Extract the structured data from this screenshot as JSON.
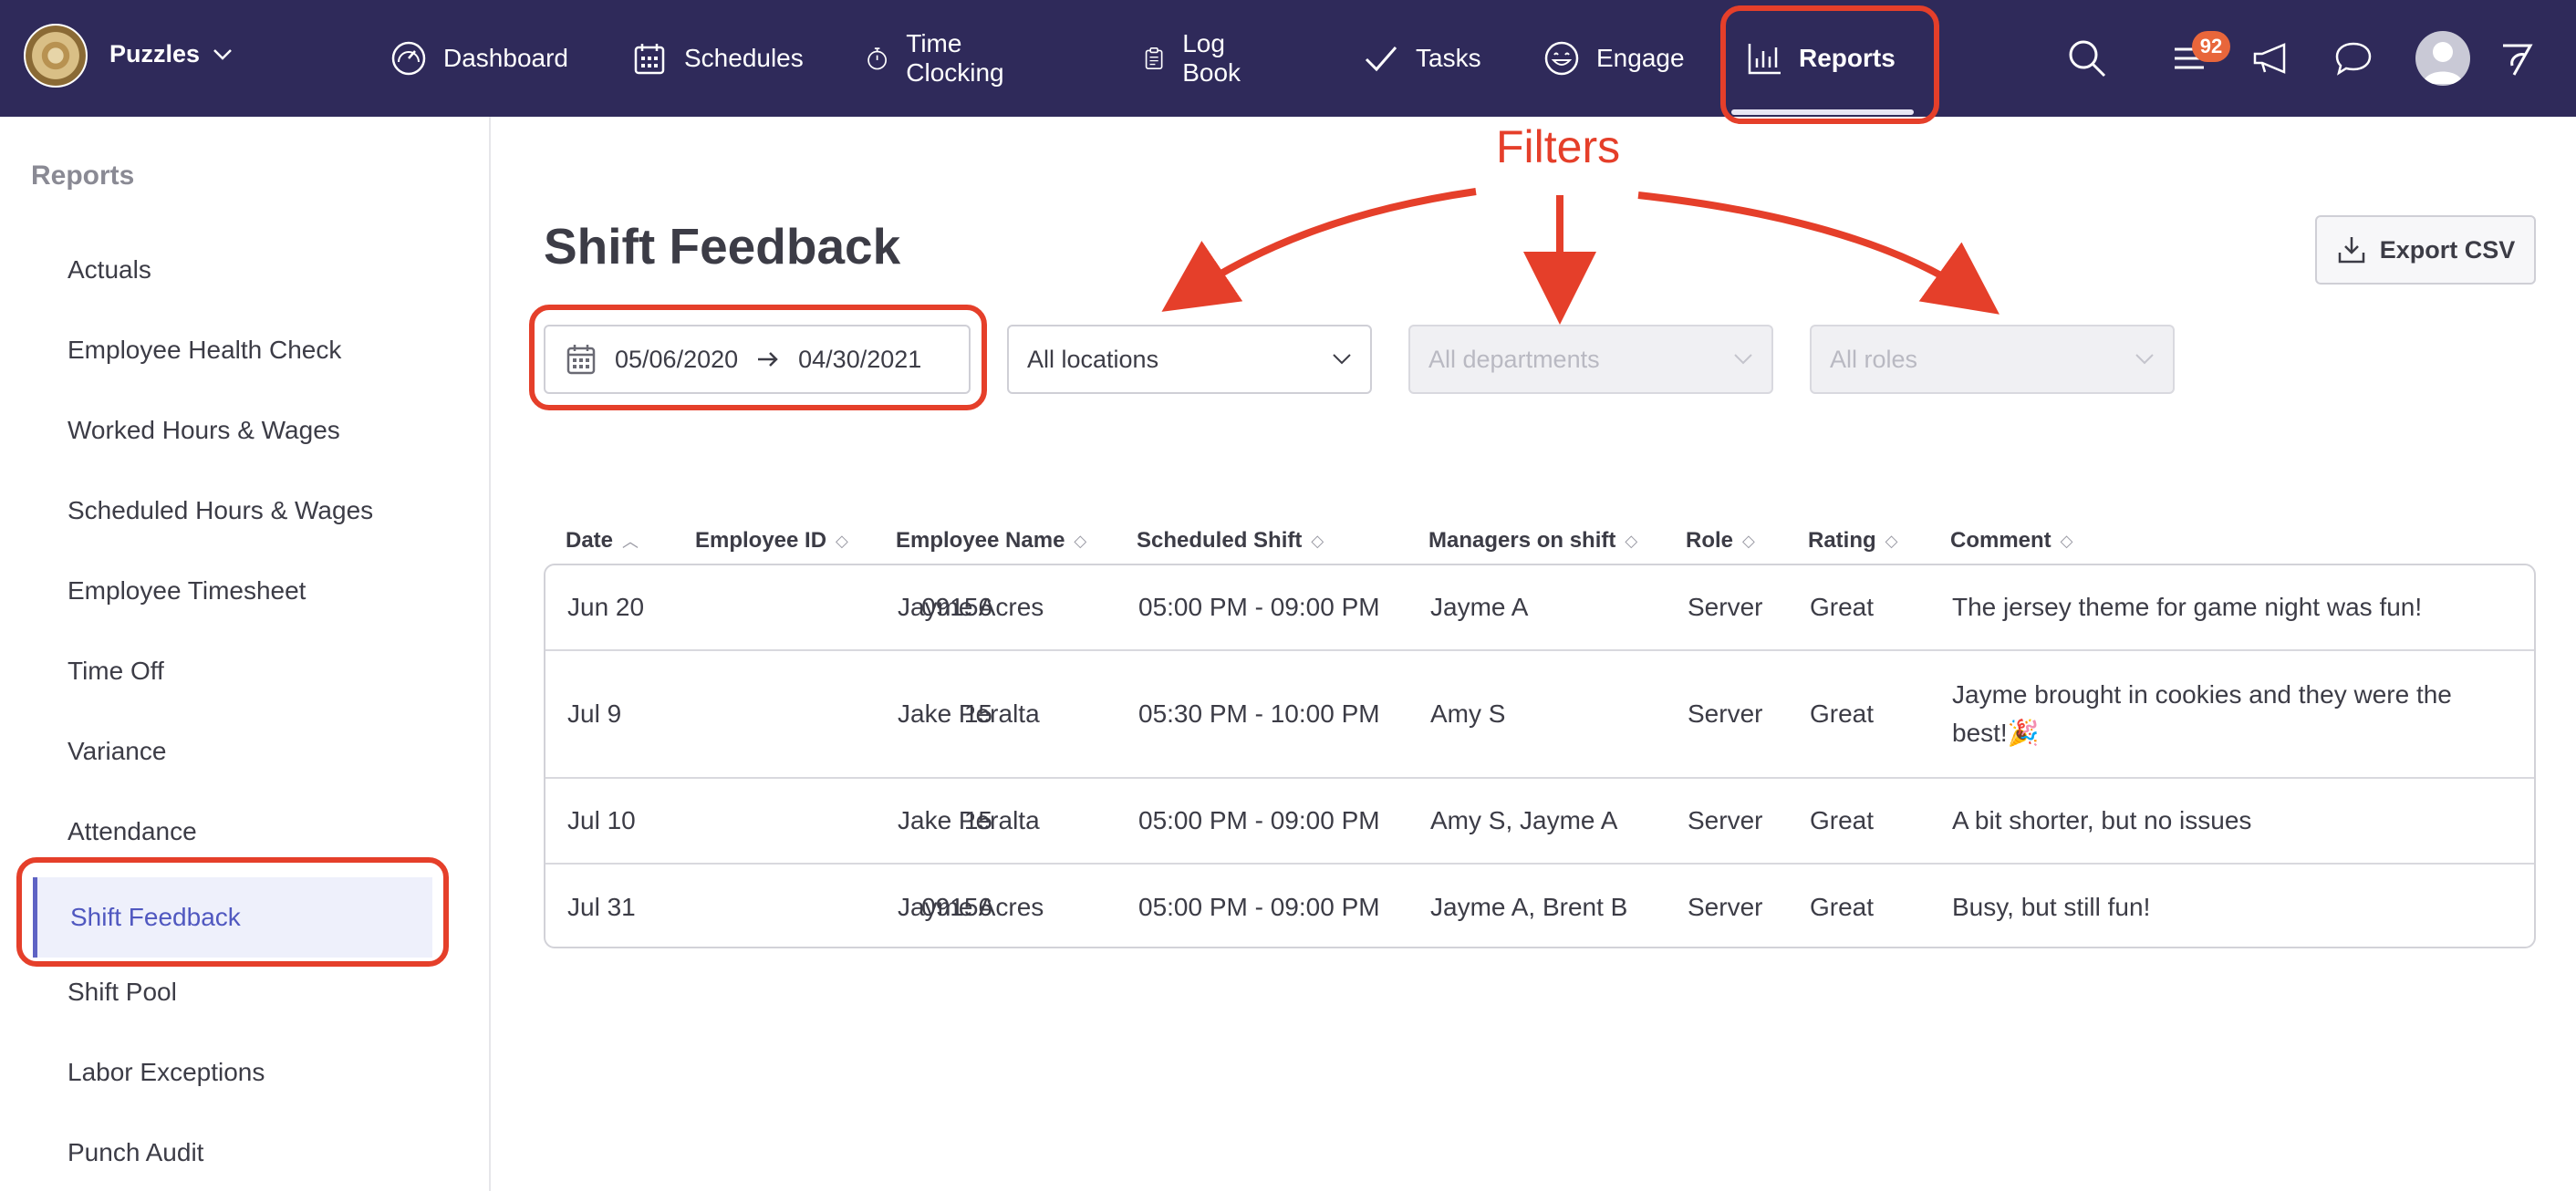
{
  "org": {
    "name": "Puzzles"
  },
  "nav": {
    "items": [
      {
        "label": "Dashboard",
        "icon": "gauge-icon"
      },
      {
        "label": "Schedules",
        "icon": "calendar-icon"
      },
      {
        "label": "Time Clocking",
        "icon": "stopwatch-icon"
      },
      {
        "label": "Log Book",
        "icon": "clipboard-icon"
      },
      {
        "label": "Tasks",
        "icon": "check-icon"
      },
      {
        "label": "Engage",
        "icon": "smile-icon"
      },
      {
        "label": "Reports",
        "icon": "bar-chart-icon",
        "active": true
      }
    ],
    "notification_count": "92"
  },
  "sidebar": {
    "title": "Reports",
    "items": [
      {
        "label": "Actuals"
      },
      {
        "label": "Employee Health Check"
      },
      {
        "label": "Worked Hours & Wages"
      },
      {
        "label": "Scheduled Hours & Wages"
      },
      {
        "label": "Employee Timesheet"
      },
      {
        "label": "Time Off"
      },
      {
        "label": "Variance"
      },
      {
        "label": "Attendance"
      },
      {
        "label": "Shift Feedback",
        "active": true
      },
      {
        "label": "Shift Pool"
      },
      {
        "label": "Labor Exceptions"
      },
      {
        "label": "Punch Audit"
      }
    ]
  },
  "page": {
    "title": "Shift Feedback",
    "export_label": "Export CSV"
  },
  "filters": {
    "date_start": "05/06/2020",
    "date_end": "04/30/2021",
    "locations": "All locations",
    "departments": "All departments",
    "roles": "All roles"
  },
  "table": {
    "columns": [
      "Date",
      "Employee ID",
      "Employee Name",
      "Scheduled Shift",
      "Managers on shift",
      "Role",
      "Rating",
      "Comment"
    ],
    "rows": [
      {
        "date": "Jun 20",
        "id": "09156",
        "name": "Jayme Acres",
        "shift": "05:00 PM - 09:00 PM",
        "managers": "Jayme A",
        "role": "Server",
        "rating": "Great",
        "comment": "The jersey theme for game night was fun!"
      },
      {
        "date": "Jul 9",
        "id": "15",
        "name": "Jake Peralta",
        "shift": "05:30 PM - 10:00 PM",
        "managers": "Amy S",
        "role": "Server",
        "rating": "Great",
        "comment": "Jayme brought in cookies and they were the best!🎉"
      },
      {
        "date": "Jul 10",
        "id": "15",
        "name": "Jake Peralta",
        "shift": "05:00 PM - 09:00 PM",
        "managers": "Amy S, Jayme A",
        "role": "Server",
        "rating": "Great",
        "comment": "A bit shorter, but no issues"
      },
      {
        "date": "Jul 31",
        "id": "09156",
        "name": "Jayme Acres",
        "shift": "05:00 PM - 09:00 PM",
        "managers": "Jayme A, Brent B",
        "role": "Server",
        "rating": "Great",
        "comment": "Busy, but still fun!"
      }
    ]
  },
  "annotation": {
    "label": "Filters",
    "color": "#e53f2a"
  },
  "colors": {
    "nav_bg": "#2f2a5a",
    "accent": "#5e63c4",
    "badge": "#e8663b"
  }
}
